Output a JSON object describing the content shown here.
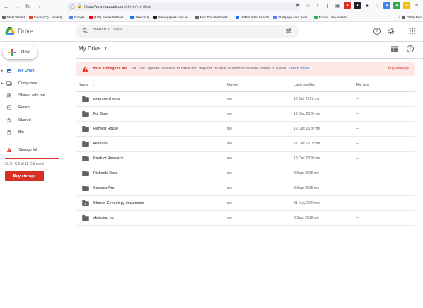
{
  "browser": {
    "url_host": "https://drive.google.com",
    "url_path": "/drive/my-drive",
    "bookmarks": [
      {
        "label": "Most Visited",
        "color": "#5f6368"
      },
      {
        "label": "Inbox (32) - smiledy...",
        "color": "#ea4335"
      },
      {
        "label": "Google",
        "color": "#4285f4"
      },
      {
        "label": "(416) Speak Without...",
        "color": "#ff0000"
      },
      {
        "label": "SketchUp",
        "color": "#1a73e8"
      },
      {
        "label": "Newspapers.com se...",
        "color": "#202124"
      },
      {
        "label": "Mac Troubleshootin...",
        "color": "#5f6368"
      },
      {
        "label": "HotBot Safe Search",
        "color": "#1a73e8"
      },
      {
        "label": "Startpage.com Sear...",
        "color": "#6573ff"
      },
      {
        "label": "Ecosia - the search ...",
        "color": "#34a853"
      }
    ],
    "bookmarks_more": "Other Boo"
  },
  "header": {
    "brand": "Drive",
    "search_placeholder": "Search in Drive"
  },
  "sidebar": {
    "new_label": "New",
    "items": [
      {
        "label": "My Drive",
        "icon": "my-drive-icon",
        "active": true
      },
      {
        "label": "Computers",
        "icon": "computers-icon"
      },
      {
        "label": "Shared with me",
        "icon": "shared-icon"
      },
      {
        "label": "Recent",
        "icon": "clock-icon"
      },
      {
        "label": "Starred",
        "icon": "star-icon"
      },
      {
        "label": "Bin",
        "icon": "bin-icon"
      }
    ],
    "storage_label": "Storage full",
    "storage_text": "23.24 GB of 15 GB used",
    "storage_fraction": 1.0,
    "buy_label": "Buy storage"
  },
  "main": {
    "title": "My Drive",
    "banner": {
      "strong": "Your storage is full.",
      "message": "You can't upload new files to Drive and may not be able to send or receive emails in Gmail.",
      "link": "Learn more",
      "action": "Buy storage"
    },
    "columns": {
      "name": "Name",
      "owner": "Owner",
      "modified": "Last modified",
      "size": "File size"
    },
    "rows": [
      {
        "name": "example sheets",
        "owner": "me",
        "modified": "18 Jan 2017 me",
        "size": "—",
        "shared": false
      },
      {
        "name": "For Sale",
        "owner": "me",
        "modified": "19 Dec 2020 me",
        "size": "—",
        "shared": false
      },
      {
        "name": "Harvest House",
        "owner": "me",
        "modified": "19 Dec 2020 me",
        "size": "—",
        "shared": false
      },
      {
        "name": "keepass",
        "owner": "me",
        "modified": "21 Dec 2019 me",
        "size": "—",
        "shared": false
      },
      {
        "name": "Product Research",
        "owner": "me",
        "modified": "19 Dec 2020 me",
        "size": "—",
        "shared": false
      },
      {
        "name": "Richards Docs",
        "owner": "me",
        "modified": "3 Sept 2016 me",
        "size": "—",
        "shared": false
      },
      {
        "name": "Scanner Pro",
        "owner": "me",
        "modified": "3 Sept 2016 me",
        "size": "—",
        "shared": false
      },
      {
        "name": "Shared Geneology documents",
        "owner": "me",
        "modified": "31 May 2020 me",
        "size": "—",
        "shared": true
      },
      {
        "name": "sketchup bu",
        "owner": "me",
        "modified": "3 Sept 2016 me",
        "size": "—",
        "shared": false
      }
    ]
  },
  "colors": {
    "accent": "#1a73e8",
    "danger": "#d93025",
    "banner_bg": "#fce8e6",
    "folder": "#5f6368"
  }
}
